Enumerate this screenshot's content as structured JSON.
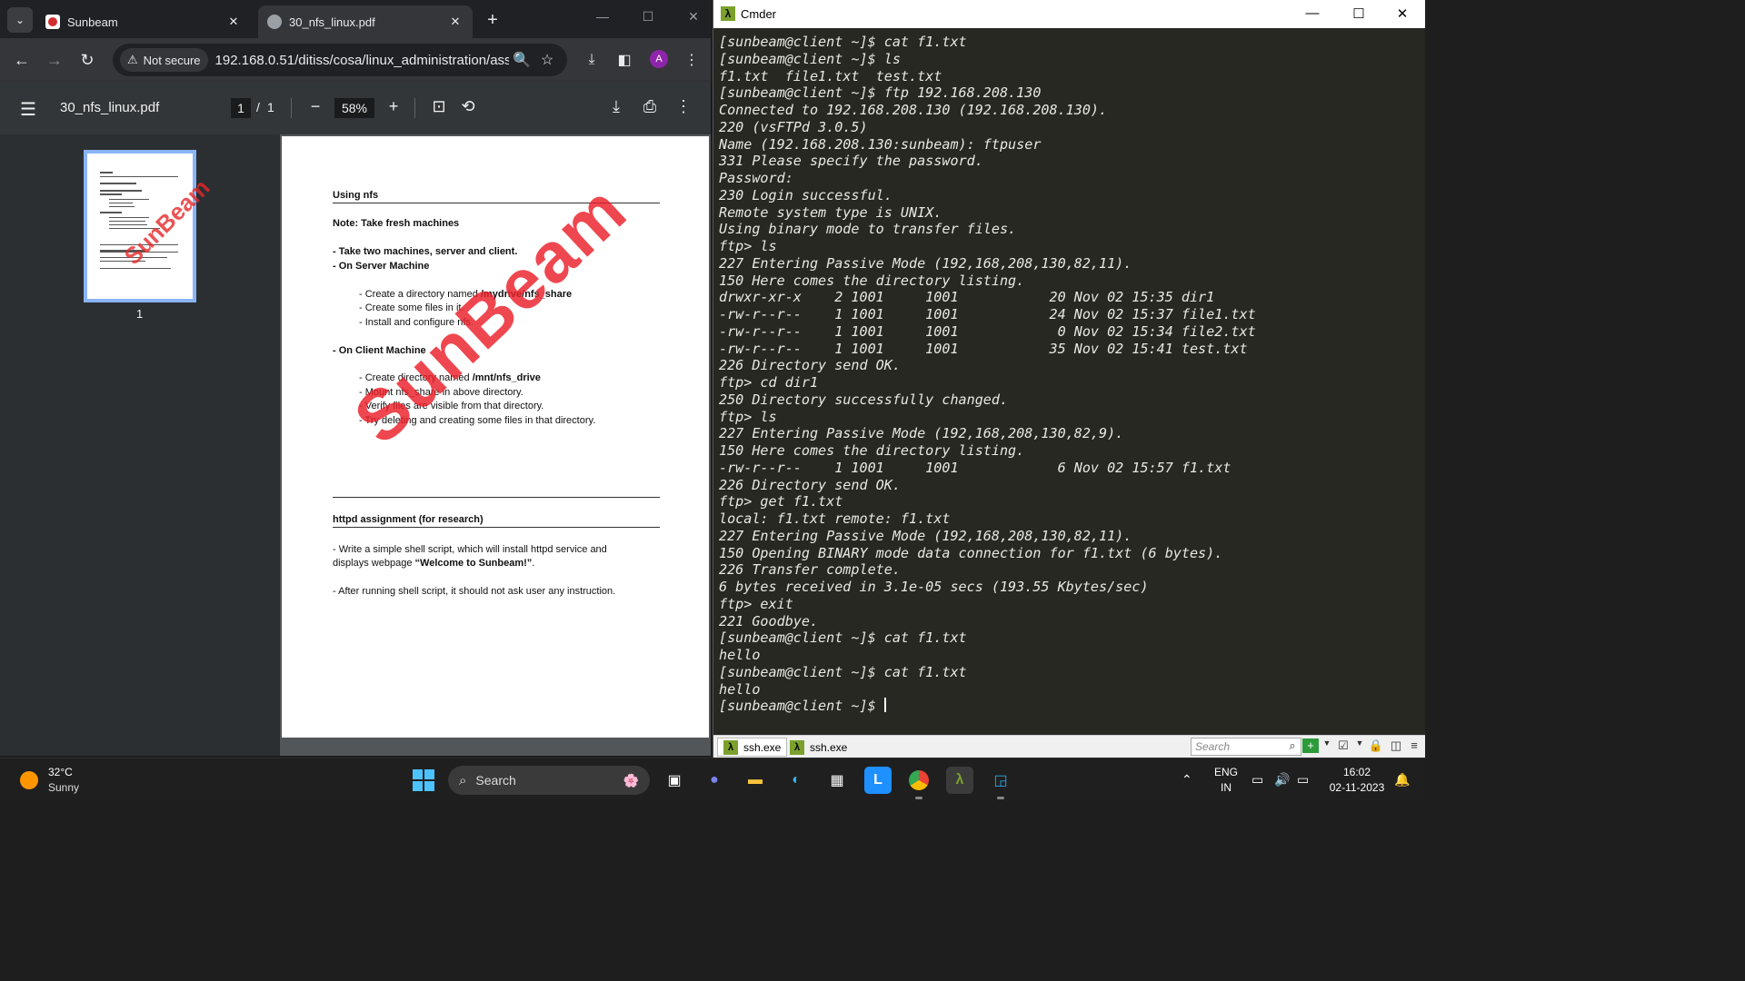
{
  "browser": {
    "tabs": [
      {
        "title": "Sunbeam",
        "active": false
      },
      {
        "title": "30_nfs_linux.pdf",
        "active": true
      }
    ],
    "security_chip": "Not secure",
    "url": "192.168.0.51/ditiss/cosa/linux_administration/assi...",
    "avatar_letter": "A",
    "icons": {
      "back": "←",
      "forward": "→",
      "reload": "↻",
      "zoom": "🔍",
      "star": "☆",
      "download": "⤓",
      "sidepanel": "◧",
      "menu": "⋮",
      "close": "✕",
      "new_tab": "+",
      "minimize": "—",
      "maximize": "☐",
      "tab_list": "⌄",
      "warning": "⚠"
    }
  },
  "pdf": {
    "filename": "30_nfs_linux.pdf",
    "current_page": "1",
    "separator": "/",
    "total_pages": "1",
    "zoom": "58%",
    "thumb_label": "1",
    "watermark": "SunBeam",
    "icons": {
      "menu": "☰",
      "zoom_out": "−",
      "zoom_in": "+",
      "fit": "⊡",
      "rotate": "⟲",
      "download": "⤓",
      "print": "⎙",
      "more": "⋮"
    },
    "content": {
      "heading1": "Using nfs",
      "note": "Note: Take fresh machines",
      "take_two": "- Take two machines, server and client.",
      "server_heading": "- On Server Machine",
      "server_1_prefix": "- Create a directory named ",
      "server_1_path": "/mydrive/nfs_share",
      "server_2": "- Create some files in it.",
      "server_3": "- Install and configure nfs.",
      "client_heading": "- On Client Machine",
      "client_1_prefix": "- Create directory named ",
      "client_1_path": "/mnt/nfs_drive",
      "client_2": "- Mount nfs_share in above directory.",
      "client_3": "- Verify files are visible from that directory.",
      "client_4": "- Try deleting and creating some files in that directory.",
      "heading2": "httpd assignment (for research)",
      "httpd_1": "- Write a simple shell script, which will install httpd service and",
      "httpd_2_prefix": "displays webpage ",
      "httpd_2_bold": "“Welcome to Sunbeam!”",
      "httpd_2_suffix": ".",
      "httpd_3": "- After running shell script, it should not ask user any instruction."
    }
  },
  "cmder": {
    "title": "Cmder",
    "controls": {
      "minimize": "—",
      "maximize": "☐",
      "close": "✕"
    },
    "lines": [
      "[sunbeam@client ~]$ cat f1.txt",
      "[sunbeam@client ~]$ ls",
      "f1.txt  file1.txt  test.txt",
      "[sunbeam@client ~]$ ftp 192.168.208.130",
      "Connected to 192.168.208.130 (192.168.208.130).",
      "220 (vsFTPd 3.0.5)",
      "Name (192.168.208.130:sunbeam): ftpuser",
      "331 Please specify the password.",
      "Password:",
      "230 Login successful.",
      "Remote system type is UNIX.",
      "Using binary mode to transfer files.",
      "ftp> ls",
      "227 Entering Passive Mode (192,168,208,130,82,11).",
      "150 Here comes the directory listing.",
      "drwxr-xr-x    2 1001     1001           20 Nov 02 15:35 dir1",
      "-rw-r--r--    1 1001     1001           24 Nov 02 15:37 file1.txt",
      "-rw-r--r--    1 1001     1001            0 Nov 02 15:34 file2.txt",
      "-rw-r--r--    1 1001     1001           35 Nov 02 15:41 test.txt",
      "226 Directory send OK.",
      "ftp> cd dir1",
      "250 Directory successfully changed.",
      "ftp> ls",
      "227 Entering Passive Mode (192,168,208,130,82,9).",
      "150 Here comes the directory listing.",
      "-rw-r--r--    1 1001     1001            6 Nov 02 15:57 f1.txt",
      "226 Directory send OK.",
      "ftp> get f1.txt",
      "local: f1.txt remote: f1.txt",
      "227 Entering Passive Mode (192,168,208,130,82,11).",
      "150 Opening BINARY mode data connection for f1.txt (6 bytes).",
      "226 Transfer complete.",
      "6 bytes received in 3.1e-05 secs (193.55 Kbytes/sec)",
      "ftp> exit",
      "221 Goodbye.",
      "[sunbeam@client ~]$ cat f1.txt",
      "hello",
      "[sunbeam@client ~]$ cat f1.txt",
      "hello"
    ],
    "prompt": "[sunbeam@client ~]$ ",
    "status_tabs": [
      "ssh.exe",
      "ssh.exe"
    ],
    "search_placeholder": "Search",
    "colors": {
      "background": "#272822",
      "text": "#e8e8e2",
      "logo": "#7ba12c"
    }
  },
  "taskbar": {
    "weather_temp": "32°C",
    "weather_desc": "Sunny",
    "search_label": "Search",
    "lang_1": "ENG",
    "lang_2": "IN",
    "time": "16:02",
    "date": "02-11-2023",
    "apps": [
      "task-view",
      "meet",
      "file-explorer",
      "edge",
      "store",
      "l-app",
      "chrome",
      "cmder",
      "remote-app"
    ]
  }
}
